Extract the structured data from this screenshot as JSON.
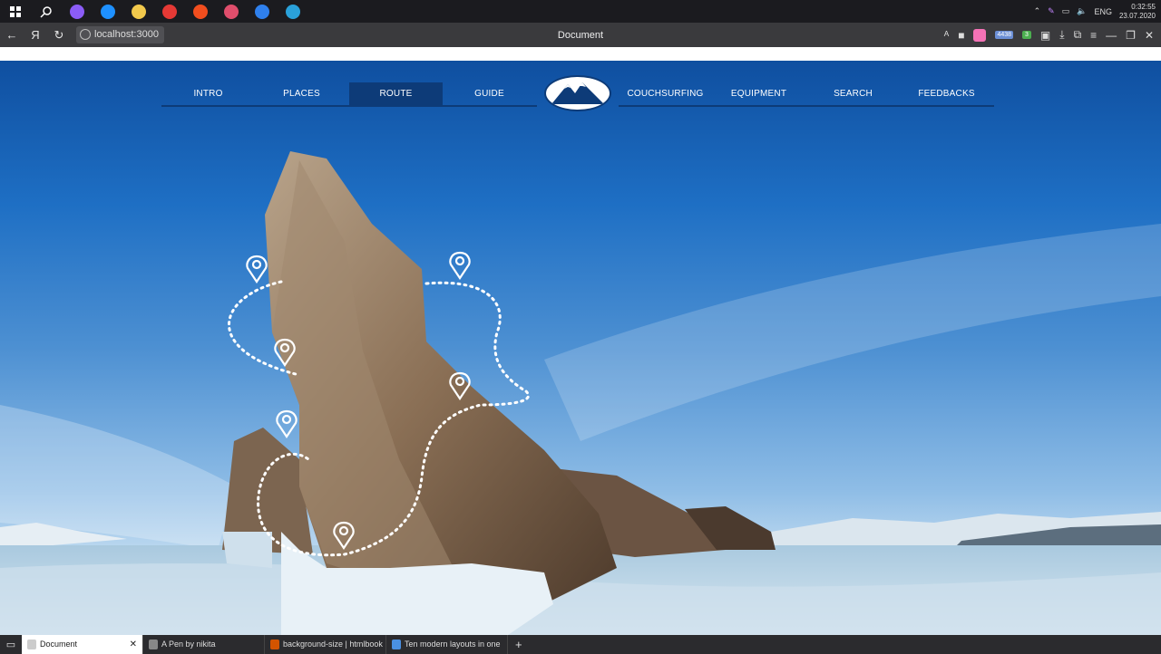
{
  "taskbar": {
    "apps": [
      {
        "name": "alice",
        "color": "#8b5cf6"
      },
      {
        "name": "edge",
        "color": "#1e90ff"
      },
      {
        "name": "explorer",
        "color": "#f2c94c"
      },
      {
        "name": "yandex",
        "color": "#e53935"
      },
      {
        "name": "figma",
        "color": "#f24e1e"
      },
      {
        "name": "app",
        "color": "#e04e6c"
      },
      {
        "name": "vscode",
        "color": "#2f80ed"
      },
      {
        "name": "telegram",
        "color": "#2aa1da"
      }
    ],
    "lang": "ENG",
    "time": "0:32:55",
    "date": "23.07.2020"
  },
  "browser": {
    "url": "localhost:3000",
    "title": "Document",
    "back": "←",
    "yandex": "Я",
    "reload": "↻",
    "badge_a": "4438",
    "badge_b": "3"
  },
  "nav": {
    "left": [
      {
        "label": "INTRO",
        "active": false
      },
      {
        "label": "PLACES",
        "active": false
      },
      {
        "label": "ROUTE",
        "active": true
      },
      {
        "label": "GUIDE",
        "active": false
      }
    ],
    "right": [
      {
        "label": "COUCHSURFING",
        "active": false
      },
      {
        "label": "EQUIPMENT",
        "active": false
      },
      {
        "label": "SEARCH",
        "active": false
      },
      {
        "label": "FEEDBACKS",
        "active": false
      }
    ]
  },
  "route_pins": 6,
  "tabs": [
    {
      "label": "Document",
      "active": true,
      "fav": "#cccccc"
    },
    {
      "label": "A Pen by nikita",
      "active": false,
      "fav": "#888888"
    },
    {
      "label": "background-size | htmlbook",
      "active": false,
      "fav": "#d35400"
    },
    {
      "label": "Ten modern layouts in one",
      "active": false,
      "fav": "#4a90e2"
    }
  ],
  "new_tab": "+",
  "colors": {
    "nav_accent": "#0d3b78",
    "sky": "#1e6fc4"
  }
}
